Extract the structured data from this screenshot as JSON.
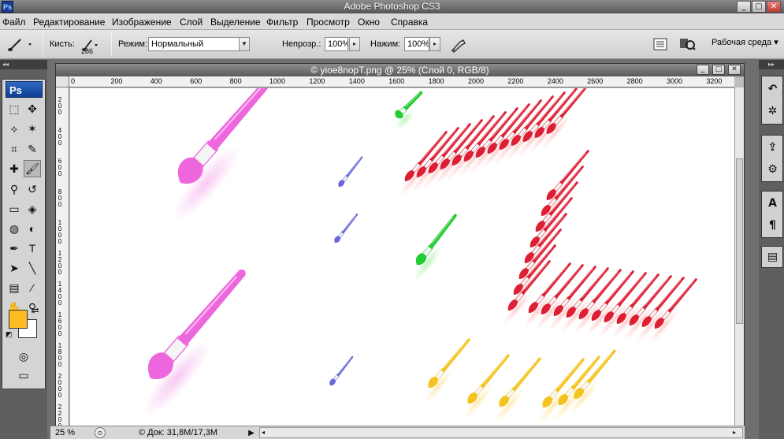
{
  "window": {
    "title": "Adobe Photoshop CS3",
    "app_icon_text": "Ps",
    "controls": [
      "_",
      "□",
      "✕"
    ]
  },
  "menu": [
    "Файл",
    "Редактирование",
    "Изображение",
    "Слой",
    "Выделение",
    "Фильтр",
    "Просмотр",
    "Окно",
    "Справка"
  ],
  "options_bar": {
    "tool_icon": "brush-icon",
    "brush_label": "Кисть:",
    "brush_size": "286",
    "mode_label": "Режим:",
    "mode_value": "Нормальный",
    "opacity_label": "Непрозр.:",
    "opacity_value": "100%",
    "flow_label": "Нажим:",
    "flow_value": "100%",
    "workspace_label": "Рабочая среда ▾"
  },
  "toolbox": {
    "logo": "Ps",
    "tools": [
      {
        "name": "marquee-tool-icon",
        "glyph": "⬚"
      },
      {
        "name": "move-tool-icon",
        "glyph": "✥"
      },
      {
        "name": "lasso-tool-icon",
        "glyph": "⟡"
      },
      {
        "name": "magic-wand-tool-icon",
        "glyph": "✶"
      },
      {
        "name": "crop-tool-icon",
        "glyph": "⌗"
      },
      {
        "name": "eyedropper-slice-icon",
        "glyph": "✎"
      },
      {
        "name": "healing-brush-tool-icon",
        "glyph": "✚"
      },
      {
        "name": "brush-tool-icon",
        "glyph": "🖌"
      },
      {
        "name": "stamp-tool-icon",
        "glyph": "⚲"
      },
      {
        "name": "history-brush-tool-icon",
        "glyph": "↺"
      },
      {
        "name": "eraser-tool-icon",
        "glyph": "▭"
      },
      {
        "name": "paint-bucket-tool-icon",
        "glyph": "◈"
      },
      {
        "name": "blur-tool-icon",
        "glyph": "◍"
      },
      {
        "name": "dodge-tool-icon",
        "glyph": "◐"
      },
      {
        "name": "pen-tool-icon",
        "glyph": "✒"
      },
      {
        "name": "type-tool-icon",
        "glyph": "T"
      },
      {
        "name": "path-selection-tool-icon",
        "glyph": "➤"
      },
      {
        "name": "line-tool-icon",
        "glyph": "╲"
      },
      {
        "name": "notes-tool-icon",
        "glyph": "▤"
      },
      {
        "name": "eyedropper-tool-icon",
        "glyph": "⁄"
      },
      {
        "name": "hand-tool-icon",
        "glyph": "✋"
      },
      {
        "name": "zoom-tool-icon",
        "glyph": "⚲"
      }
    ],
    "foreground_color": "#ffbb22",
    "background_color": "#ffffff"
  },
  "document": {
    "title": "© yioe8nopT.png @ 25% (Слой 0, RGB/8)",
    "hruler_labels": [
      "0",
      "200",
      "400",
      "600",
      "800",
      "1000",
      "1200",
      "1400",
      "1600",
      "1800",
      "2000",
      "2200",
      "2400",
      "2600",
      "2800",
      "3000",
      "3200"
    ],
    "vruler_labels": [
      "200",
      "400",
      "600",
      "800",
      "1000",
      "1200",
      "1400",
      "1600",
      "1800",
      "2000",
      "2200"
    ],
    "zoom": "25 %",
    "doc_info": "© Док: 31,8M/17,3M"
  },
  "colors": {
    "pink": "#ee66dd",
    "red": "#dd1f35",
    "green": "#22cc33",
    "blue": "#6666dd",
    "yellow": "#f5c320"
  }
}
